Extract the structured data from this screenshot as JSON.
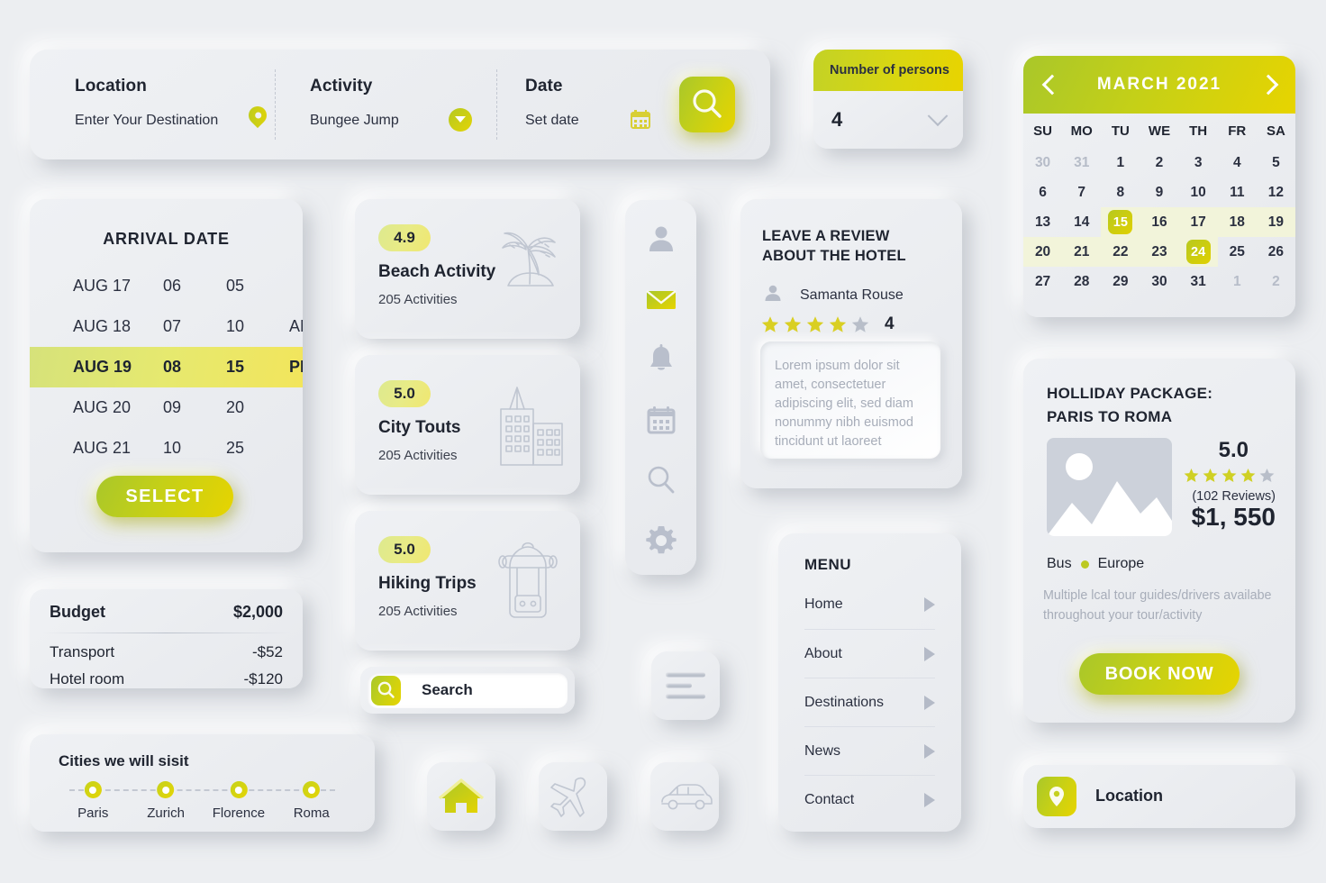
{
  "colors": {
    "bg": "#eceef1",
    "accent_green": "#a9c72a",
    "accent_yellow": "#e7d400",
    "text": "#1f2430",
    "muted": "#a7adb9"
  },
  "search_bar": {
    "fields": [
      {
        "title": "Location",
        "value": "Enter Your Destination",
        "icon": "map-pin-icon"
      },
      {
        "title": "Activity",
        "value": "Bungee Jump",
        "icon": "chevron-down-circle-icon"
      },
      {
        "title": "Date",
        "value": "Set date",
        "icon": "calendar-icon"
      }
    ],
    "submit_icon": "search-icon"
  },
  "persons": {
    "label": "Number of persons",
    "value": "4",
    "icon": "chevron-down-icon"
  },
  "calendar": {
    "month": "MARCH  2021",
    "prev_icon": "chevron-left-icon",
    "next_icon": "chevron-right-icon",
    "dow": [
      "SU",
      "MO",
      "TU",
      "WE",
      "TH",
      "FR",
      "SA"
    ],
    "weeks": [
      [
        {
          "d": "30",
          "mute": true
        },
        {
          "d": "31",
          "mute": true
        },
        {
          "d": "1"
        },
        {
          "d": "2"
        },
        {
          "d": "3"
        },
        {
          "d": "4"
        },
        {
          "d": "5"
        }
      ],
      [
        {
          "d": "6"
        },
        {
          "d": "7"
        },
        {
          "d": "8"
        },
        {
          "d": "9"
        },
        {
          "d": "10"
        },
        {
          "d": "11"
        },
        {
          "d": "12"
        }
      ],
      [
        {
          "d": "13"
        },
        {
          "d": "14"
        },
        {
          "d": "15",
          "sel": true,
          "inrange": true
        },
        {
          "d": "16",
          "inrange": true
        },
        {
          "d": "17",
          "inrange": true
        },
        {
          "d": "18",
          "inrange": true
        },
        {
          "d": "19",
          "inrange": true
        }
      ],
      [
        {
          "d": "20",
          "inrange": true
        },
        {
          "d": "21",
          "inrange": true
        },
        {
          "d": "22",
          "inrange": true
        },
        {
          "d": "23",
          "inrange": true
        },
        {
          "d": "24",
          "sel": true,
          "inrange": true
        },
        {
          "d": "25"
        },
        {
          "d": "26"
        }
      ],
      [
        {
          "d": "27"
        },
        {
          "d": "28"
        },
        {
          "d": "29"
        },
        {
          "d": "30"
        },
        {
          "d": "31"
        },
        {
          "d": "1",
          "mute": true
        },
        {
          "d": "2",
          "mute": true
        }
      ]
    ]
  },
  "arrival": {
    "title": "ARRIVAL DATE",
    "rows": [
      {
        "date": "AUG 17",
        "hour": "06",
        "min": "05",
        "mer": "",
        "selected": false
      },
      {
        "date": "AUG 18",
        "hour": "07",
        "min": "10",
        "mer": "AM",
        "selected": false
      },
      {
        "date": "AUG 19",
        "hour": "08",
        "min": "15",
        "mer": "PM",
        "selected": true
      },
      {
        "date": "AUG 20",
        "hour": "09",
        "min": "20",
        "mer": "",
        "selected": false
      },
      {
        "date": "AUG 21",
        "hour": "10",
        "min": "25",
        "mer": "",
        "selected": false
      }
    ],
    "select_label": "SELECT"
  },
  "budget": {
    "label": "Budget",
    "total": "$2,000",
    "items": [
      {
        "label": "Transport",
        "value": "-$52"
      },
      {
        "label": "Hotel room",
        "value": "-$120"
      }
    ]
  },
  "cities": {
    "title": "Cities we will sisit",
    "stops": [
      "Paris",
      "Zurich",
      "Florence",
      "Roma"
    ]
  },
  "activities": [
    {
      "rating": "4.9",
      "title": "Beach Activity",
      "subtitle": "205 Activities",
      "icon": "palm-tree-icon"
    },
    {
      "rating": "5.0",
      "title": "City Touts",
      "subtitle": "205 Activities",
      "icon": "buildings-icon"
    },
    {
      "rating": "5.0",
      "title": "Hiking Trips",
      "subtitle": "205 Activities",
      "icon": "backpack-icon"
    }
  ],
  "rail": {
    "icons": [
      "user-icon",
      "mail-icon",
      "bell-icon",
      "calendar-icon",
      "search-icon",
      "gear-icon"
    ],
    "active": "mail-icon"
  },
  "review": {
    "title": "LEAVE A REVIEW ABOUT THE HOTEL",
    "author": "Samanta Rouse",
    "avatar_icon": "user-avatar-icon",
    "stars_filled": 4,
    "stars_total": 5,
    "score": "4",
    "placeholder": "Lorem ipsum dolor sit amet, consectetuer adipiscing elit, sed diam nonummy nibh euismod tincidunt ut laoreet"
  },
  "menu": {
    "title": "MENU",
    "items": [
      "Home",
      "About",
      "Destinations",
      "News",
      "Contact"
    ],
    "chevron_icon": "triangle-right-icon"
  },
  "search_field": {
    "icon": "search-icon",
    "placeholder": "Search"
  },
  "tiles": {
    "hamburger_icon": "hamburger-menu-icon",
    "home_icon": "home-icon",
    "plane_icon": "airplane-icon",
    "car_icon": "car-icon"
  },
  "package": {
    "title_line1": "HOLLIDAY PACKAGE:",
    "title_line2": "PARIS TO ROMA",
    "image_icon": "mountain-photo-icon",
    "score": "5.0",
    "stars_filled": 4,
    "stars_total": 5,
    "reviews": "(102 Reviews)",
    "price": "$1, 550",
    "transport": "Bus",
    "region": "Europe",
    "description": "Multiple lcal tour guides/drivers availabe throughout your tour/activity",
    "cta": "BOOK NOW"
  },
  "location_bar": {
    "icon": "map-pin-icon",
    "label": "Location"
  }
}
